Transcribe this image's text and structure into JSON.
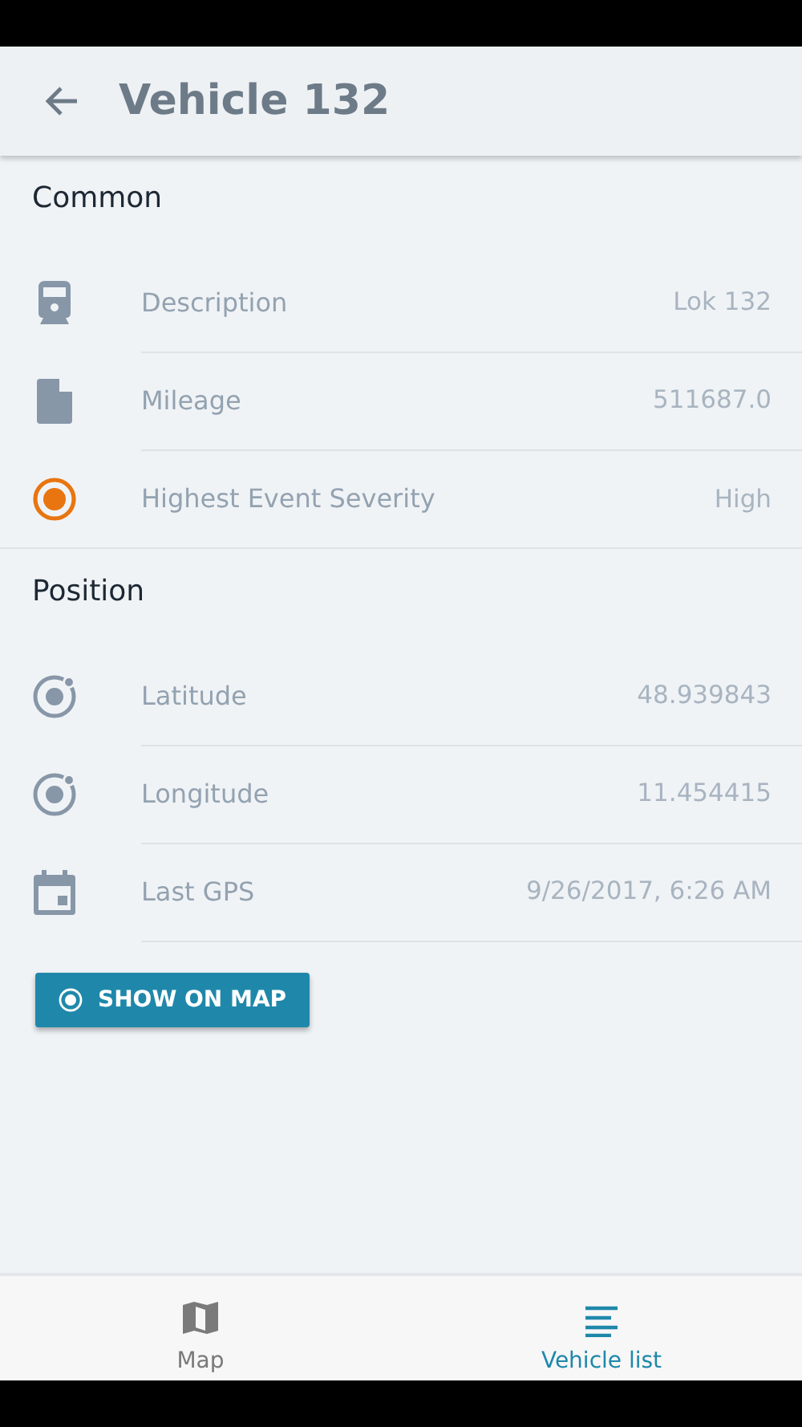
{
  "header": {
    "title": "Vehicle 132"
  },
  "sections": [
    {
      "title": "Common",
      "rows": [
        {
          "label": "Description",
          "value": "Lok 132"
        },
        {
          "label": "Mileage",
          "value": "511687.0"
        },
        {
          "label": "Highest Event Severity",
          "value": "High",
          "color": "#e8750f"
        }
      ]
    },
    {
      "title": "Position",
      "rows": [
        {
          "label": "Latitude",
          "value": "48.939843"
        },
        {
          "label": "Longitude",
          "value": "11.454415"
        },
        {
          "label": "Last GPS",
          "value": "9/26/2017, 6:26 AM"
        }
      ],
      "button": "SHOW ON MAP"
    }
  ],
  "bottom_nav": [
    {
      "label": "Map",
      "selected": false
    },
    {
      "label": "Vehicle list",
      "selected": true
    }
  ]
}
